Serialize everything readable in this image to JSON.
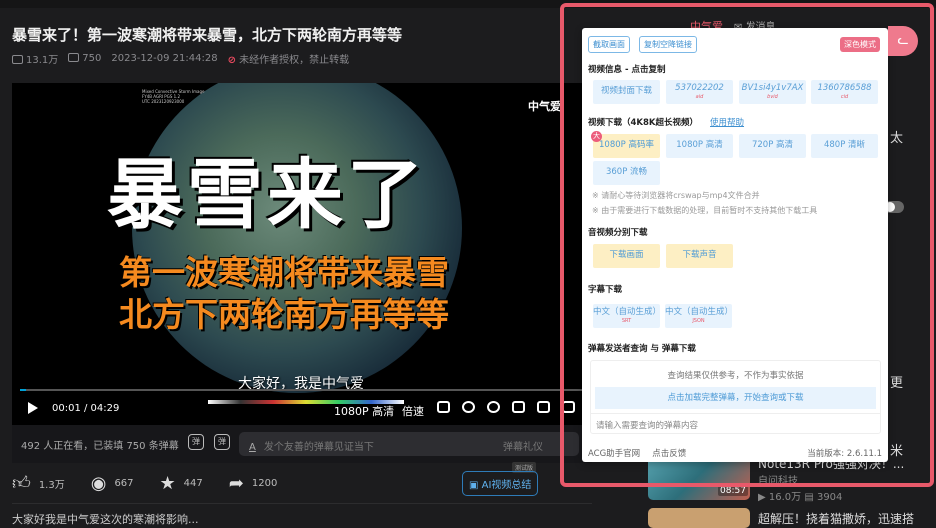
{
  "video": {
    "title": "暴雪来了！第一波寒潮将带来暴雪，北方下两轮南方再等等",
    "views": "13.1万",
    "danmaku": "750",
    "date": "2023-12-09 21:44:28",
    "copyright": "未经作者授权，禁止转载",
    "sat_text": [
      "Mixed Convective Storm Image",
      "FY4B AGRI PGS 1.2",
      "UTC 2023120923000"
    ],
    "overlay_main": "暴雪来了",
    "overlay_line1": "第一波寒潮将带来暴雪",
    "overlay_line2": "北方下两轮南方再等等",
    "caption": "大家好，我是中气爱",
    "watermark": "中气爱",
    "time": "00:01 / 04:29",
    "progress": 0.004,
    "quality": "1080P 高清",
    "speed": "倍速"
  },
  "danmaku_bar": {
    "status": "492 人正在看，已装填 750 条弹幕",
    "toggle_icon": "弹",
    "setting_icon": "弹",
    "a_icon": "A",
    "placeholder": "发个友善的弹幕见证当下",
    "etiquette": "弹幕礼仪"
  },
  "actions": {
    "like": "1.3万",
    "coin": "667",
    "fav": "447",
    "share": "1200",
    "ai": "AI视频总结",
    "beta": "测试版"
  },
  "description": "大家好我是中气爱这次的寒潮将影响...",
  "sidebar": {
    "up_name": "中气爱",
    "message": "发消息",
    "frag1": "太",
    "frag2": "更",
    "frag3": "米",
    "card1": {
      "title": "Note13R Pro强强对决！...",
      "author": "自问科技",
      "views": "16.0万",
      "danmaku": "3904",
      "duration": "08:57"
    },
    "card2": {
      "title": "超解压！挠着猫撒娇，迅速搭"
    }
  },
  "popup": {
    "screenshot": "截取画面",
    "copy_link": "复制空降链接",
    "dark_mode": "深色模式",
    "info_title": "视频信息 - 点击复制",
    "cover": "视频封面下载",
    "aid": "537022202",
    "aid_label": "aid",
    "bvid": "BV1si4y1v7AX",
    "bvid_label": "bvid",
    "cid": "1360786588",
    "cid_label": "cid",
    "dl_title": "视频下载（4K8K超长视频）",
    "help": "使用帮助",
    "big_badge": "大",
    "qualities": [
      "1080P 高码率",
      "1080P 高清",
      "720P 高清",
      "480P 清晰",
      "360P 流畅"
    ],
    "note1": "※ 请耐心等待浏览器将crswap与mp4文件合并",
    "note2": "※ 由于需要进行下载数据的处理，目前暂时不支持其他下载工具",
    "av_title": "音视频分别下载",
    "dl_video": "下载画面",
    "dl_audio": "下载声音",
    "sub_title": "字幕下载",
    "sub1": "中文（自动生成）",
    "sub1_fmt": "SRT",
    "sub2": "中文（自动生成）",
    "sub2_fmt": "JSON",
    "dm_title": "弹幕发送者查询 与 弹幕下载",
    "dm_notice": "查询结果仅供参考，不作为事实依据",
    "dm_load": "点击加载完整弹幕，开始查询或下载",
    "dm_placeholder": "请输入需要查询的弹幕内容",
    "site": "ACG助手官网",
    "feedback": "点击反馈",
    "version": "当前版本: 2.6.11.1"
  }
}
